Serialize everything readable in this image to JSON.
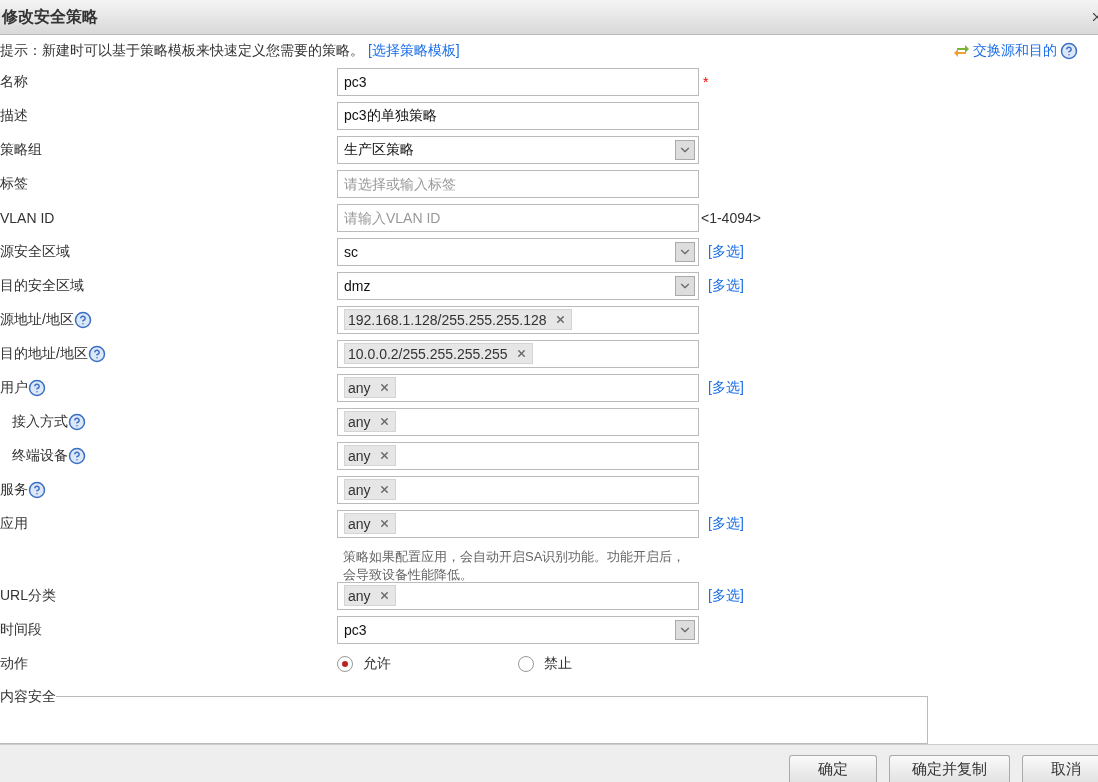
{
  "window": {
    "title": "修改安全策略"
  },
  "tip": {
    "text": "提示：新建时可以基于策略模板来快速定义您需要的策略。",
    "link": "[选择策略模板]"
  },
  "swap_link": {
    "label": "交换源和目的",
    "help": true
  },
  "fields": [
    {
      "label": "名称",
      "kind": "text",
      "value": "pc3",
      "required_mark": "*"
    },
    {
      "label": "描述",
      "kind": "text",
      "value": "pc3的单独策略"
    },
    {
      "label": "策略组",
      "kind": "select",
      "value": "生产区策略"
    },
    {
      "label": "标签",
      "kind": "text",
      "placeholder": "请选择或输入标签"
    },
    {
      "label": "VLAN ID",
      "kind": "text",
      "placeholder": "请输入VLAN ID",
      "suffix": "<1-4094>"
    },
    {
      "label": "源安全区域",
      "kind": "select",
      "value": "sc",
      "link": "[多选]"
    },
    {
      "label": "目的安全区域",
      "kind": "select",
      "value": "dmz",
      "link": "[多选]"
    },
    {
      "label": "源地址/地区",
      "kind": "tags",
      "help": true,
      "tags": [
        "192.168.1.128/255.255.255.128"
      ]
    },
    {
      "label": "目的地址/地区",
      "kind": "tags",
      "help": true,
      "tags": [
        "10.0.0.2/255.255.255.255"
      ]
    },
    {
      "label": "用户",
      "kind": "tags",
      "help": true,
      "tags": [
        "any"
      ],
      "link": "[多选]"
    },
    {
      "label": "接入方式",
      "kind": "tags",
      "help": true,
      "indented": true,
      "tags": [
        "any"
      ]
    },
    {
      "label": "终端设备",
      "kind": "tags",
      "help": true,
      "indented": true,
      "tags": [
        "any"
      ]
    },
    {
      "label": "服务",
      "kind": "tags",
      "help": true,
      "tags": [
        "any"
      ]
    },
    {
      "label": "应用",
      "kind": "tags",
      "tags": [
        "any"
      ],
      "link": "[多选]",
      "note": "策略如果配置应用，会自动开启SA识别功能。功能开启后，会导致设备性能降低。"
    },
    {
      "label": "URL分类",
      "kind": "tags",
      "tags": [
        "any"
      ],
      "link": "[多选]"
    },
    {
      "label": "时间段",
      "kind": "select",
      "value": "pc3"
    },
    {
      "label": "动作",
      "kind": "radio",
      "options": [
        {
          "label": "允许",
          "selected": true
        },
        {
          "label": "禁止",
          "selected": false
        }
      ]
    }
  ],
  "section": {
    "legend": "内容安全"
  },
  "buttons": [
    "确定",
    "确定并复制",
    "取消"
  ]
}
